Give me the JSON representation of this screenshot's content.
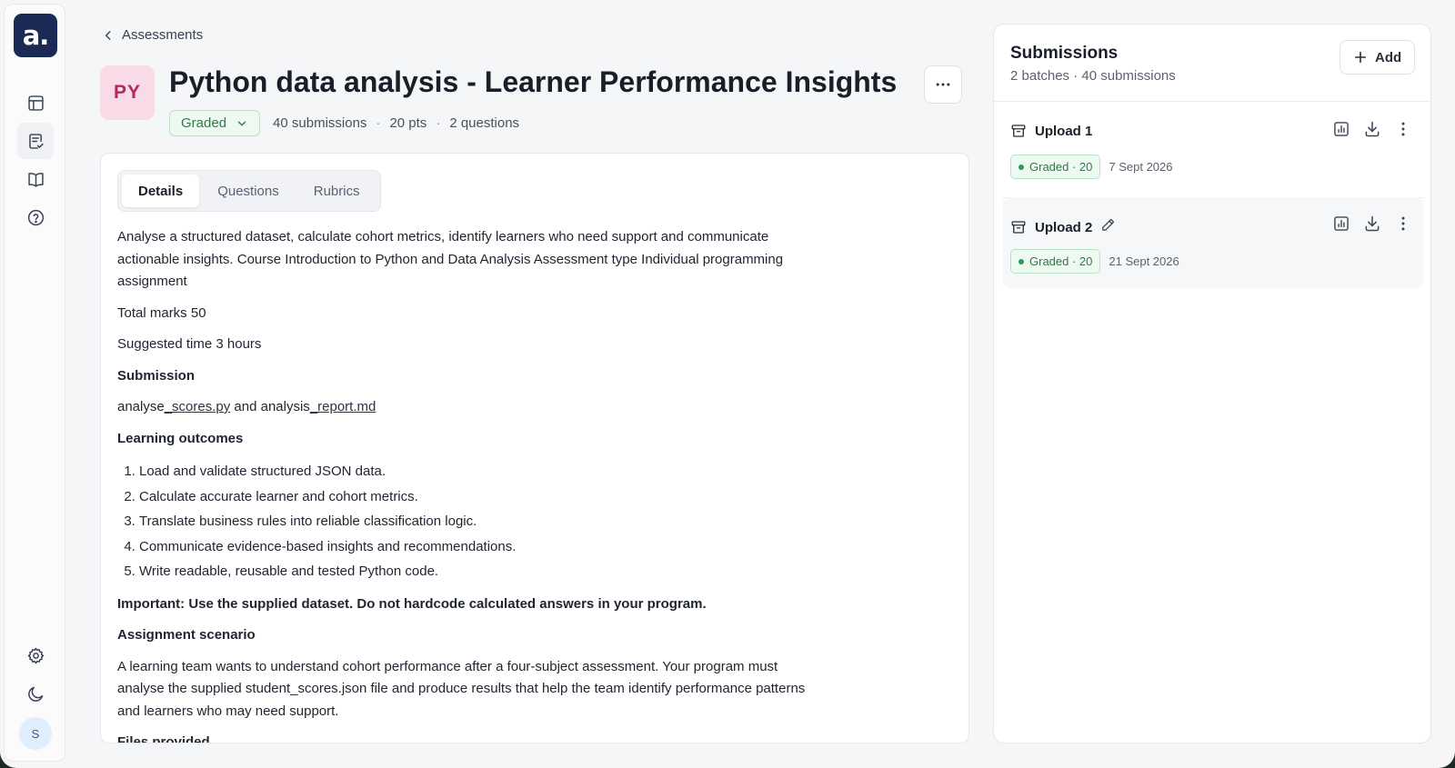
{
  "sidebar": {
    "logo_text": "a.",
    "avatar_initial": "S",
    "items": [
      {
        "name": "dashboard-icon"
      },
      {
        "name": "assessments-icon",
        "active": true
      },
      {
        "name": "book-icon"
      },
      {
        "name": "help-icon"
      },
      {
        "name": "settings-icon"
      },
      {
        "name": "moon-icon"
      }
    ]
  },
  "header": {
    "breadcrumb": "Assessments",
    "badge": "PY",
    "title": "Python data analysis - Learner Performance Insights",
    "status": "Graded",
    "submissions": "40 submissions",
    "points": "20 pts",
    "questions": "2 questions",
    "separator": "·"
  },
  "tabs": [
    "Details",
    "Questions",
    "Rubrics"
  ],
  "details": {
    "intro": "Analyse a structured dataset, calculate cohort metrics, identify learners who need support and communicate actionable insights. Course Introduction to Python and Data Analysis Assessment type Individual programming assignment",
    "total_marks": "Total marks 50",
    "suggested_time": "Suggested time 3 hours",
    "submission_heading": "Submission",
    "submission_text_1": "analyse",
    "submission_link_1": "_scores.py",
    "submission_text_2": " and analysis",
    "submission_link_2": "_report.md",
    "outcomes_heading": "Learning outcomes",
    "outcomes": [
      "Load and validate structured JSON data.",
      "Calculate accurate learner and cohort metrics.",
      "Translate business rules into reliable classification logic.",
      "Communicate evidence-based insights and recommendations.",
      "Write readable, reusable and tested Python code."
    ],
    "important": "Important: Use the supplied dataset. Do not hardcode calculated answers in your program.",
    "scenario_heading": "Assignment scenario",
    "scenario_text": "A learning team wants to understand cohort performance after a four-subject assessment. Your program must analyse the supplied student_scores.json file and produce results that help the team identify performance patterns and learners who may need support.",
    "files_heading": "Files provided"
  },
  "submissions": {
    "title": "Submissions",
    "subtitle": "2 batches · 40 submissions",
    "add_label": "Add",
    "batches": [
      {
        "name": "Upload 1",
        "status": "Graded · 20",
        "date": "7 Sept 2026"
      },
      {
        "name": "Upload 2",
        "status": "Graded · 20",
        "date": "21 Sept 2026"
      }
    ]
  },
  "colors": {
    "brand": "#1b2a55",
    "graded_text": "#2c7b47",
    "graded_bg": "#eef9f1",
    "badge_bg": "#f9dbe8",
    "badge_text": "#b02a5e"
  }
}
